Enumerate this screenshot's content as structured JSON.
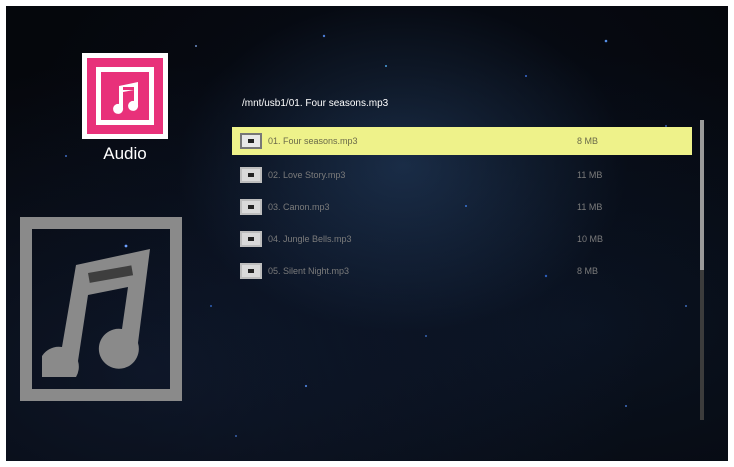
{
  "app": {
    "label": "Audio",
    "icon": "music-note-icon",
    "accent": "#e8317a"
  },
  "browser": {
    "path": "/mnt/usb1/01. Four seasons.mp3",
    "selected_color": "#eef28a",
    "files": [
      {
        "name": "01. Four seasons.mp3",
        "size": "8 MB",
        "selected": true
      },
      {
        "name": "02. Love Story.mp3",
        "size": "11 MB",
        "selected": false
      },
      {
        "name": "03. Canon.mp3",
        "size": "11 MB",
        "selected": false
      },
      {
        "name": "04. Jungle Bells.mp3",
        "size": "10 MB",
        "selected": false
      },
      {
        "name": "05. Silent Night.mp3",
        "size": "8 MB",
        "selected": false
      }
    ]
  },
  "preview": {
    "icon": "music-note-icon"
  },
  "scroll": {
    "position": 0.0,
    "visible_fraction": 0.5
  }
}
